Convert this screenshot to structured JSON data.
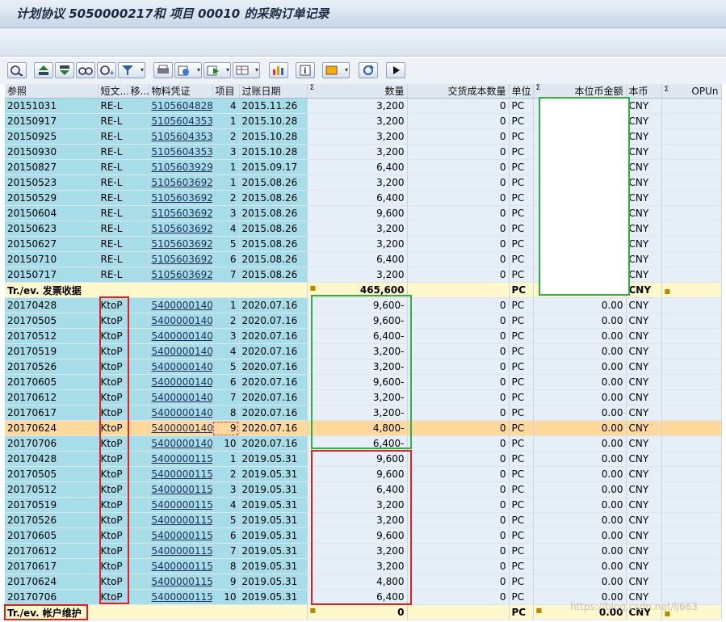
{
  "title": "计划协议 5050000217和 项目 00010 的采购订单记录",
  "columns": [
    "参照",
    "短文...",
    "移...",
    "物料凭证",
    "项目",
    "过账日期",
    "数量",
    "交货成本数量",
    "单位",
    "本位币金额",
    "本币",
    "OPUn"
  ],
  "sigma": "Σ",
  "rows_a": [
    [
      "20151031",
      "RE-L",
      "",
      "5105604828",
      "4",
      "2015.11.26",
      "3,200",
      "0",
      "PC",
      "",
      "CNY",
      ""
    ],
    [
      "20150917",
      "RE-L",
      "",
      "5105604353",
      "1",
      "2015.10.28",
      "3,200",
      "0",
      "PC",
      "",
      "CNY",
      ""
    ],
    [
      "20150925",
      "RE-L",
      "",
      "5105604353",
      "2",
      "2015.10.28",
      "3,200",
      "0",
      "PC",
      "",
      "CNY",
      ""
    ],
    [
      "20150930",
      "RE-L",
      "",
      "5105604353",
      "3",
      "2015.10.28",
      "3,200",
      "0",
      "PC",
      "",
      "CNY",
      ""
    ],
    [
      "20150827",
      "RE-L",
      "",
      "5105603929",
      "1",
      "2015.09.17",
      "6,400",
      "0",
      "PC",
      "",
      "CNY",
      ""
    ],
    [
      "20150523",
      "RE-L",
      "",
      "5105603692",
      "1",
      "2015.08.26",
      "3,200",
      "0",
      "PC",
      "",
      "CNY",
      ""
    ],
    [
      "20150529",
      "RE-L",
      "",
      "5105603692",
      "2",
      "2015.08.26",
      "6,400",
      "0",
      "PC",
      "",
      "CNY",
      ""
    ],
    [
      "20150604",
      "RE-L",
      "",
      "5105603692",
      "3",
      "2015.08.26",
      "9,600",
      "0",
      "PC",
      "",
      "CNY",
      ""
    ],
    [
      "20150623",
      "RE-L",
      "",
      "5105603692",
      "4",
      "2015.08.26",
      "3,200",
      "0",
      "PC",
      "",
      "CNY",
      ""
    ],
    [
      "20150627",
      "RE-L",
      "",
      "5105603692",
      "5",
      "2015.08.26",
      "3,200",
      "0",
      "PC",
      "",
      "CNY",
      ""
    ],
    [
      "20150710",
      "RE-L",
      "",
      "5105603692",
      "6",
      "2015.08.26",
      "6,400",
      "0",
      "PC",
      "",
      "CNY",
      ""
    ],
    [
      "20150717",
      "RE-L",
      "",
      "5105603692",
      "7",
      "2015.08.26",
      "3,200",
      "0",
      "PC",
      "",
      "CNY",
      ""
    ]
  ],
  "subtotal_a": {
    "label": "Tr./ev. 发票收据",
    "qty": "465,600",
    "unit": "PC",
    "curr": "CNY"
  },
  "rows_b": [
    [
      "20170428",
      "KtoP",
      "",
      "5400000140",
      "1",
      "2020.07.16",
      "9,600-",
      "0",
      "PC",
      "0.00",
      "CNY",
      ""
    ],
    [
      "20170505",
      "KtoP",
      "",
      "5400000140",
      "2",
      "2020.07.16",
      "9,600-",
      "0",
      "PC",
      "0.00",
      "CNY",
      ""
    ],
    [
      "20170512",
      "KtoP",
      "",
      "5400000140",
      "3",
      "2020.07.16",
      "6,400-",
      "0",
      "PC",
      "0.00",
      "CNY",
      ""
    ],
    [
      "20170519",
      "KtoP",
      "",
      "5400000140",
      "4",
      "2020.07.16",
      "3,200-",
      "0",
      "PC",
      "0.00",
      "CNY",
      ""
    ],
    [
      "20170526",
      "KtoP",
      "",
      "5400000140",
      "5",
      "2020.07.16",
      "3,200-",
      "0",
      "PC",
      "0.00",
      "CNY",
      ""
    ],
    [
      "20170605",
      "KtoP",
      "",
      "5400000140",
      "6",
      "2020.07.16",
      "9,600-",
      "0",
      "PC",
      "0.00",
      "CNY",
      ""
    ],
    [
      "20170612",
      "KtoP",
      "",
      "5400000140",
      "7",
      "2020.07.16",
      "3,200-",
      "0",
      "PC",
      "0.00",
      "CNY",
      ""
    ],
    [
      "20170617",
      "KtoP",
      "",
      "5400000140",
      "8",
      "2020.07.16",
      "3,200-",
      "0",
      "PC",
      "0.00",
      "CNY",
      ""
    ],
    [
      "20170624",
      "KtoP",
      "",
      "5400000140",
      "9",
      "2020.07.16",
      "4,800-",
      "0",
      "PC",
      "0.00",
      "CNY",
      ""
    ],
    [
      "20170706",
      "KtoP",
      "",
      "5400000140",
      "10",
      "2020.07.16",
      "6,400-",
      "0",
      "PC",
      "0.00",
      "CNY",
      ""
    ],
    [
      "20170428",
      "KtoP",
      "",
      "5400000115",
      "1",
      "2019.05.31",
      "9,600",
      "0",
      "PC",
      "0.00",
      "CNY",
      ""
    ],
    [
      "20170505",
      "KtoP",
      "",
      "5400000115",
      "2",
      "2019.05.31",
      "9,600",
      "0",
      "PC",
      "0.00",
      "CNY",
      ""
    ],
    [
      "20170512",
      "KtoP",
      "",
      "5400000115",
      "3",
      "2019.05.31",
      "6,400",
      "0",
      "PC",
      "0.00",
      "CNY",
      ""
    ],
    [
      "20170519",
      "KtoP",
      "",
      "5400000115",
      "4",
      "2019.05.31",
      "3,200",
      "0",
      "PC",
      "0.00",
      "CNY",
      ""
    ],
    [
      "20170526",
      "KtoP",
      "",
      "5400000115",
      "5",
      "2019.05.31",
      "3,200",
      "0",
      "PC",
      "0.00",
      "CNY",
      ""
    ],
    [
      "20170605",
      "KtoP",
      "",
      "5400000115",
      "6",
      "2019.05.31",
      "9,600",
      "0",
      "PC",
      "0.00",
      "CNY",
      ""
    ],
    [
      "20170612",
      "KtoP",
      "",
      "5400000115",
      "7",
      "2019.05.31",
      "3,200",
      "0",
      "PC",
      "0.00",
      "CNY",
      ""
    ],
    [
      "20170617",
      "KtoP",
      "",
      "5400000115",
      "8",
      "2019.05.31",
      "3,200",
      "0",
      "PC",
      "0.00",
      "CNY",
      ""
    ],
    [
      "20170624",
      "KtoP",
      "",
      "5400000115",
      "9",
      "2019.05.31",
      "4,800",
      "0",
      "PC",
      "0.00",
      "CNY",
      ""
    ],
    [
      "20170706",
      "KtoP",
      "",
      "5400000115",
      "10",
      "2019.05.31",
      "6,400",
      "0",
      "PC",
      "0.00",
      "CNY",
      ""
    ]
  ],
  "selected_row_b": 8,
  "subtotal_b": {
    "label": "Tr./ev. 帐户维护",
    "qty": "0",
    "unit": "PC",
    "amount": "0.00",
    "curr": "CNY"
  },
  "toolbar_icons": [
    "details-icon",
    "sort-ascending-icon",
    "sort-descending-icon",
    "find-icon",
    "filter-icon",
    "print-preview-icon",
    "export-icon",
    "send-icon",
    "layout-icon",
    "chart-icon",
    "info-icon",
    "layout-select-icon",
    "refresh-icon",
    "execute-icon"
  ],
  "watermark": "https://blog.csdn.net/lj663"
}
